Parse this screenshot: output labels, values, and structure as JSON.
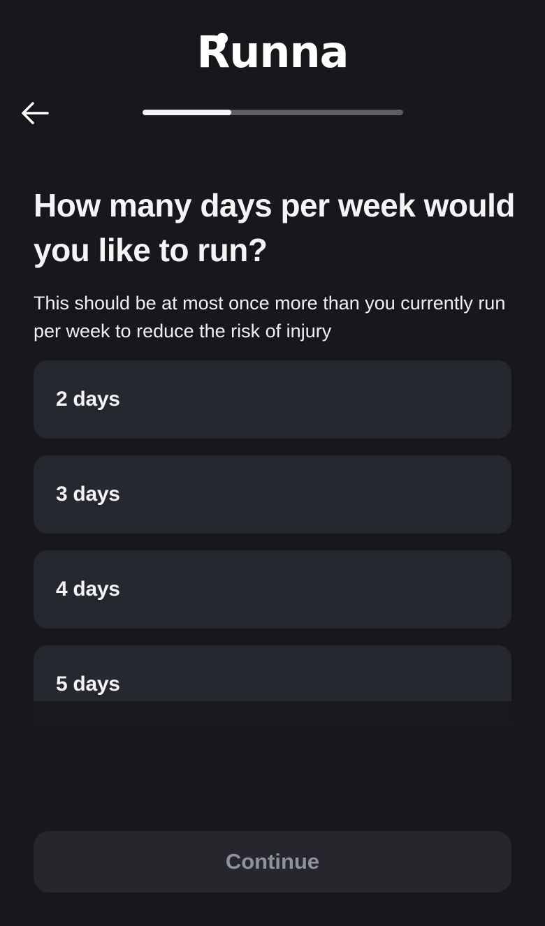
{
  "app": {
    "logo_text": "Runna"
  },
  "nav": {
    "back_icon": "arrow-left-icon"
  },
  "progress": {
    "fraction": 0.34
  },
  "question": {
    "title": "How many days per week would you like to run?",
    "subtitle": "This should be at most once more than you currently run per week to reduce the risk of injury"
  },
  "options": [
    {
      "label": "2 days"
    },
    {
      "label": "3 days"
    },
    {
      "label": "4 days"
    },
    {
      "label": "5 days"
    }
  ],
  "footer": {
    "continue_label": "Continue"
  },
  "colors": {
    "background": "#18171b",
    "card": "#262830",
    "progress_track": "#5d5e66",
    "progress_fill": "#f2f2f4",
    "button_disabled_text": "#8f929b"
  }
}
